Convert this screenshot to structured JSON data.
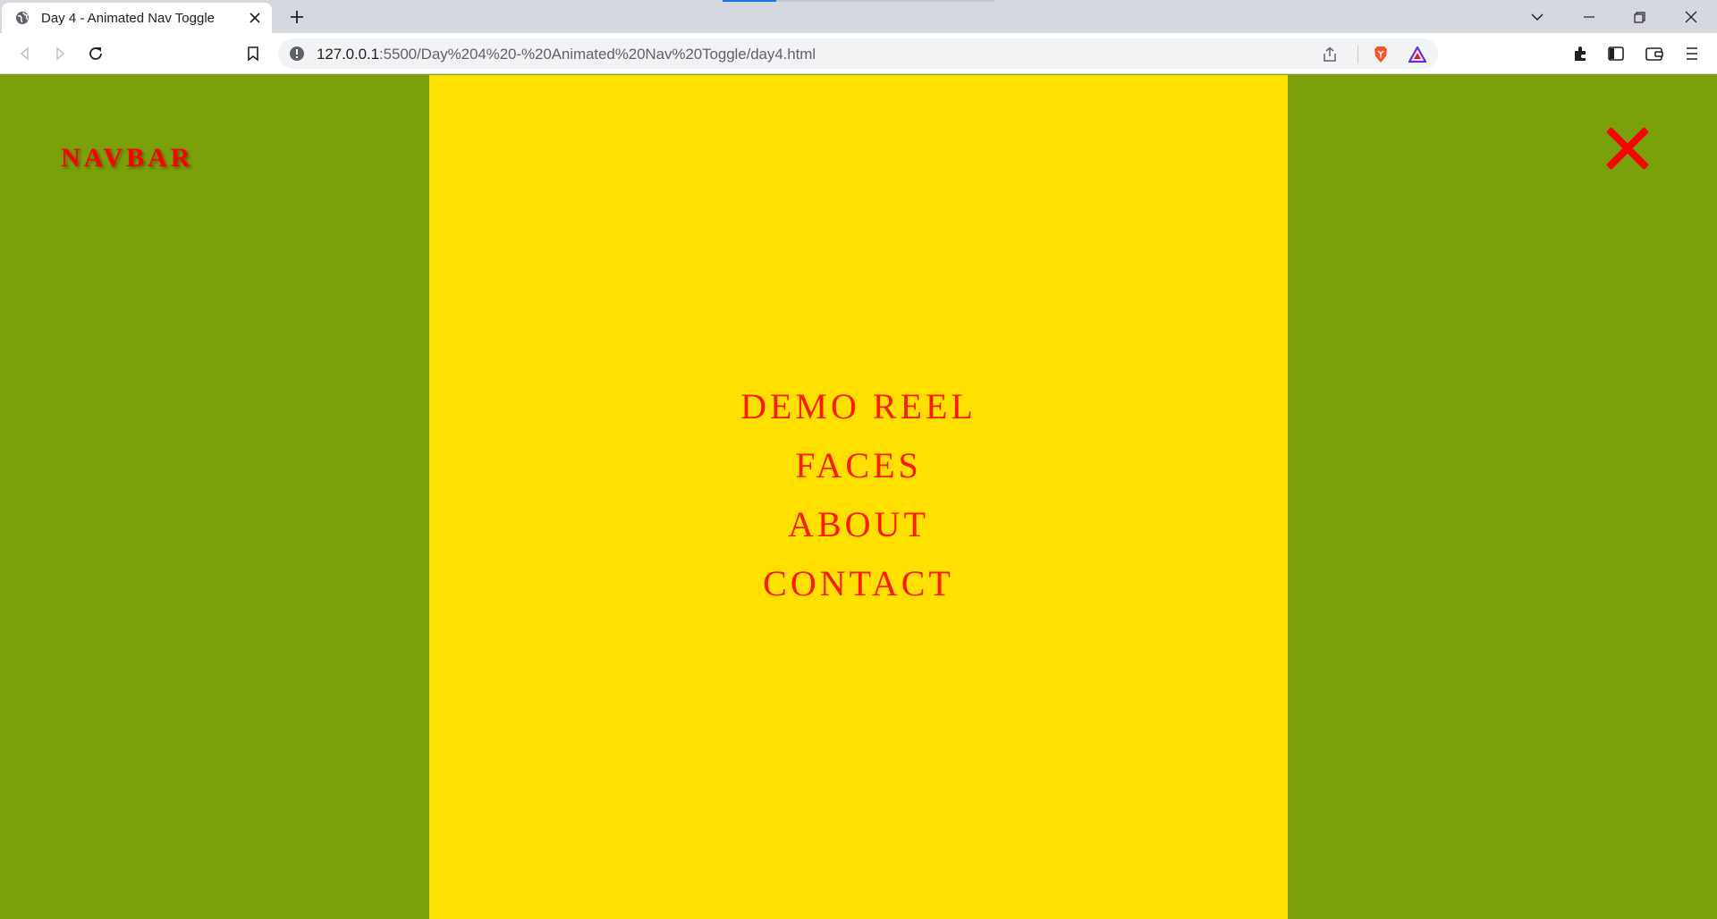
{
  "browser": {
    "tab_title": "Day 4 - Animated Nav Toggle",
    "url_host": "127.0.0.1",
    "url_rest": ":5500/Day%204%20-%20Animated%20Nav%20Toggle/day4.html"
  },
  "page": {
    "brand": "NAVBAR",
    "menu_items": [
      "DEMO REEL",
      "FACES",
      "ABOUT",
      "CONTACT"
    ]
  },
  "colors": {
    "background": "#7aa00b",
    "menu_panel": "#ffe000",
    "accent": "#ff0000"
  },
  "icons": {
    "close_menu": "close-icon",
    "tab": "globe-icon"
  }
}
